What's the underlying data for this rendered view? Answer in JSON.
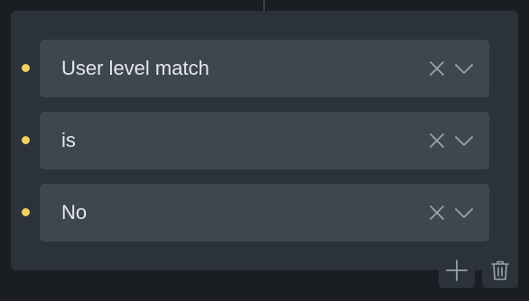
{
  "filter": {
    "rows": [
      {
        "value": "User level match"
      },
      {
        "value": "is"
      },
      {
        "value": "No"
      }
    ]
  },
  "colors": {
    "bullet": "#f0d060",
    "panel": "#2c3239",
    "select_bg": "#3e4650",
    "icon": "#9aa3ad"
  },
  "icons": {
    "clear": "close-x-icon",
    "dropdown": "chevron-down-icon",
    "add": "plus-icon",
    "delete": "trash-icon"
  }
}
